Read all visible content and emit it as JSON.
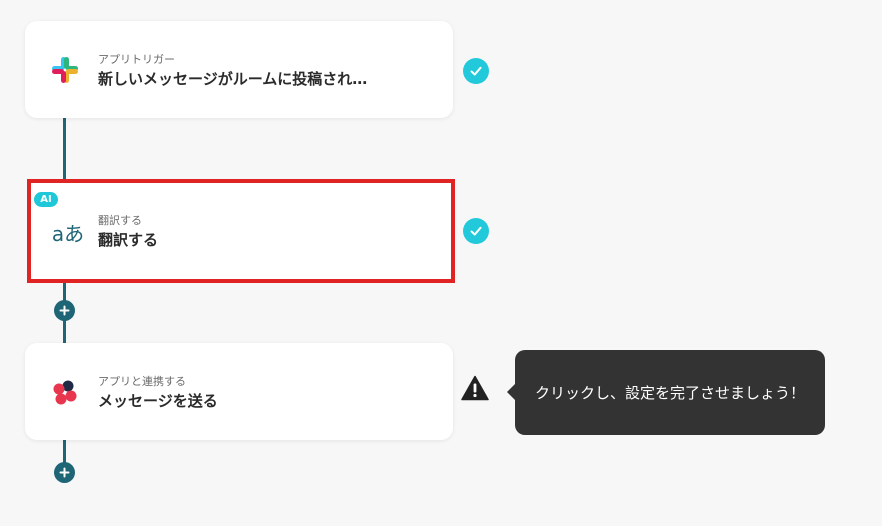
{
  "flow": {
    "steps": [
      {
        "sub": "アプリトリガー",
        "title": "新しいメッセージがルームに投稿され…",
        "icon": "slack-icon",
        "status": "completed"
      },
      {
        "sub": "翻訳する",
        "title": "翻訳する",
        "icon": "translate-icon",
        "badge": "AI",
        "status": "completed"
      },
      {
        "sub": "アプリと連携する",
        "title": "メッセージを送る",
        "icon": "app-icon",
        "status": "warning"
      }
    ],
    "translate_glyph": "aあ",
    "tooltip": "クリックし、設定を完了させましょう！"
  },
  "colors": {
    "accent": "#22c9db",
    "line": "#1e6576",
    "highlight": "#e02424",
    "tooltip_bg": "#333333"
  }
}
